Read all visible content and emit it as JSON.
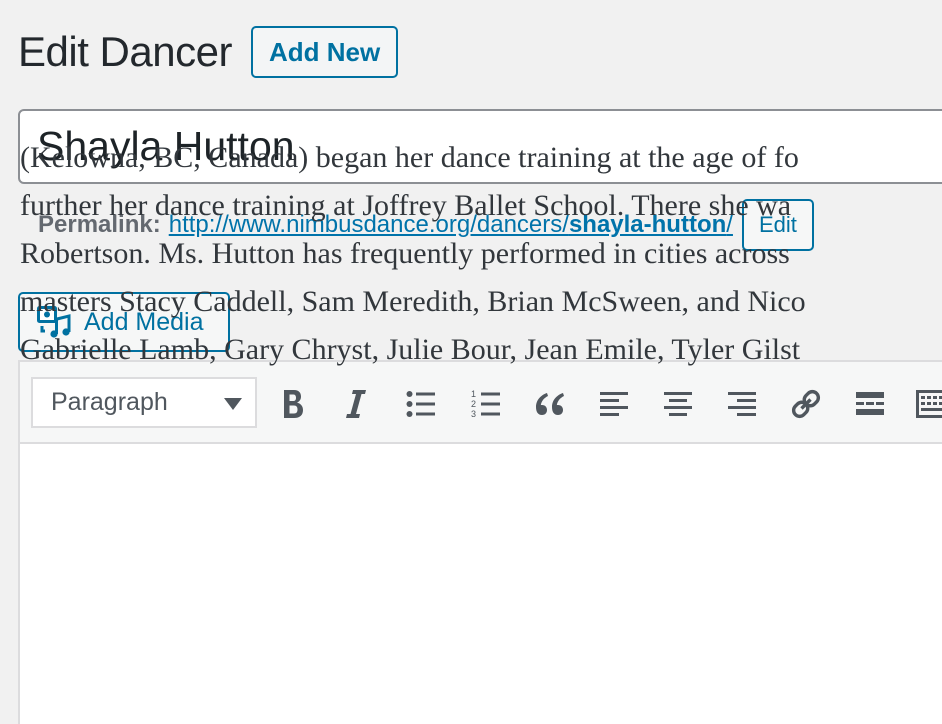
{
  "header": {
    "title": "Edit Dancer",
    "add_new_label": "Add New"
  },
  "post": {
    "title": "Shayla Hutton"
  },
  "permalink": {
    "label": "Permalink:",
    "url_base": "http://www.nimbusdance.org/dancers/",
    "slug": "shayla-hutton",
    "url_suffix": "/",
    "edit_label": "Edit"
  },
  "media": {
    "add_media_label": "Add Media"
  },
  "toolbar": {
    "format_value": "Paragraph",
    "buttons": [
      "bold-icon",
      "italic-icon",
      "bullet-list-icon",
      "numbered-list-icon",
      "blockquote-icon",
      "align-left-icon",
      "align-center-icon",
      "align-right-icon",
      "link-icon",
      "read-more-icon",
      "toolbar-toggle-icon"
    ]
  },
  "content": {
    "lines": [
      "(Kelowna, BC, Canada) began her dance training at the age of fo",
      "further her dance training at Joffrey Ballet School. There she wa",
      "Robertson. Ms. Hutton has frequently performed in cities across",
      "masters Stacy Caddell, Sam Meredith, Brian McSween, and Nico",
      "Gabrielle Lamb, Gary Chryst, Julie Bour, Jean Emile, Tyler Gilst"
    ]
  },
  "colors": {
    "accent": "#0071a1",
    "link": "#0073aa",
    "background": "#f1f1f1",
    "icon": "#50575e"
  }
}
